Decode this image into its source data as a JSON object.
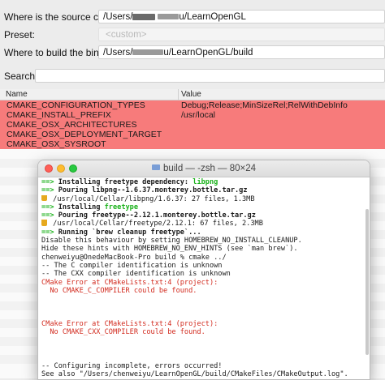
{
  "cmake": {
    "source_label": "Where is the source code:",
    "source_value_prefix": "/Users/",
    "source_value_suffix": "u/LearnOpenGL",
    "preset_label": "Preset:",
    "preset_value": "<custom>",
    "build_label": "Where to build the binaries:",
    "build_value_prefix": "/Users/",
    "build_value_suffix": "u/LearnOpenGL/build",
    "search_label": "Search:",
    "search_value": "",
    "columns": [
      "Name",
      "Value"
    ],
    "rows": [
      {
        "name": "CMAKE_CONFIGURATION_TYPES",
        "value": "Debug;Release;MinSizeRel;RelWithDebInfo"
      },
      {
        "name": "CMAKE_INSTALL_PREFIX",
        "value": "/usr/local"
      },
      {
        "name": "CMAKE_OSX_ARCHITECTURES",
        "value": ""
      },
      {
        "name": "CMAKE_OSX_DEPLOYMENT_TARGET",
        "value": ""
      },
      {
        "name": "CMAKE_OSX_SYSROOT",
        "value": ""
      }
    ]
  },
  "terminal": {
    "title": "build — -zsh — 80×24",
    "lines": [
      {
        "arrow": "==>",
        "text": " Installing freetype dependency: ",
        "accent": "libpng"
      },
      {
        "arrow": "==>",
        "text": " Pouring libpng--1.6.37.monterey.bottle.tar.gz"
      },
      {
        "beer": true,
        "text": " /usr/local/Cellar/libpng/1.6.37: 27 files, 1.3MB"
      },
      {
        "arrow": "==>",
        "text": " Installing ",
        "accent": "freetype"
      },
      {
        "arrow": "==>",
        "text": " Pouring freetype--2.12.1.monterey.bottle.tar.gz"
      },
      {
        "beer": true,
        "text": " /usr/local/Cellar/freetype/2.12.1: 67 files, 2.3MB"
      },
      {
        "arrow": "==>",
        "text": " Running `brew cleanup freetype`..."
      },
      {
        "text": "Disable this behaviour by setting HOMEBREW_NO_INSTALL_CLEANUP."
      },
      {
        "text": "Hide these hints with HOMEBREW_NO_ENV_HINTS (see `man brew`)."
      },
      {
        "text": "chenweiyu@OnedeMacBook-Pro build % cmake ../"
      },
      {
        "text": "-- The C compiler identification is unknown"
      },
      {
        "text": "-- The CXX compiler identification is unknown"
      },
      {
        "red": true,
        "text": "CMake Error at CMakeLists.txt:4 (project):"
      },
      {
        "red": true,
        "text": "  No CMAKE_C_COMPILER could be found."
      },
      {
        "text": ""
      },
      {
        "text": ""
      },
      {
        "text": ""
      },
      {
        "red": true,
        "text": "CMake Error at CMakeLists.txt:4 (project):"
      },
      {
        "red": true,
        "text": "  No CMAKE_CXX_COMPILER could be found."
      },
      {
        "text": ""
      },
      {
        "text": ""
      },
      {
        "text": ""
      },
      {
        "text": "-- Configuring incomplete, errors occurred!"
      },
      {
        "text": "See also \"/Users/chenweiyu/LearnOpenGL/build/CMakeFiles/CMakeOutput.log\"."
      }
    ]
  }
}
